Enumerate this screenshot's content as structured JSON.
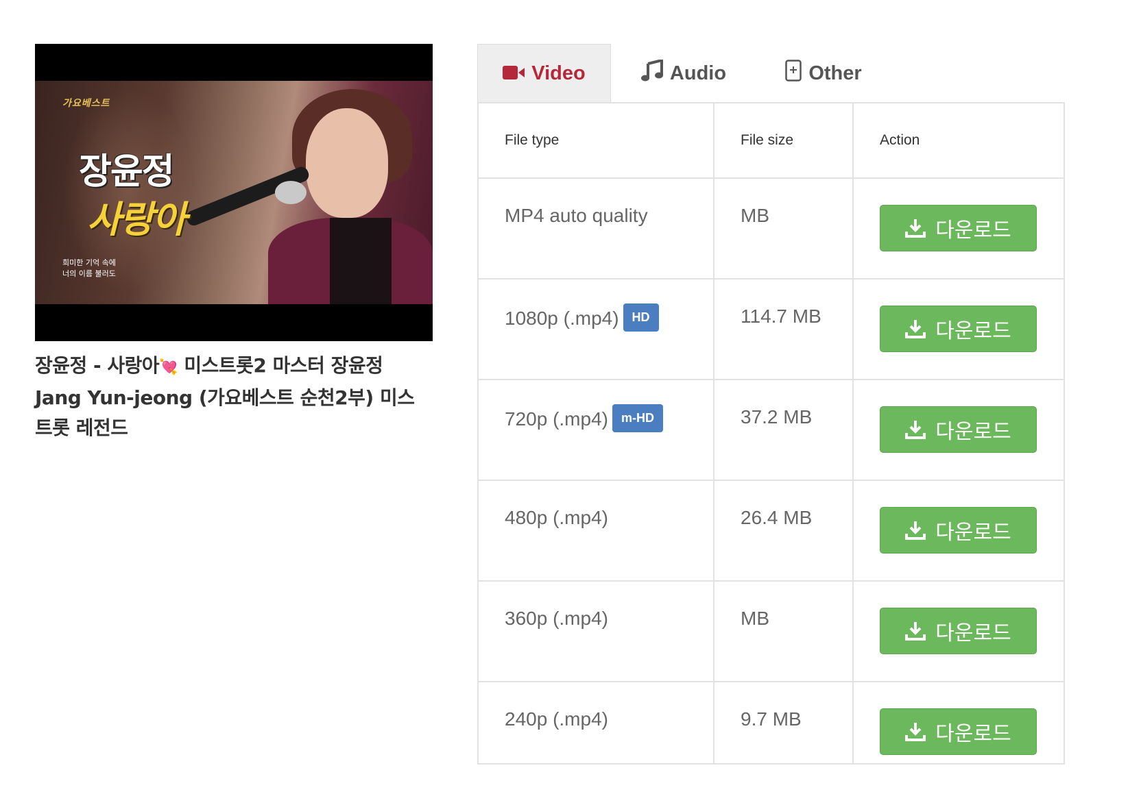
{
  "video": {
    "thumbnail": {
      "logo_text": "가요베스트",
      "title_line1": "장윤정",
      "title_line2": "사랑아",
      "subtitle_line1": "희미한 기억 속에",
      "subtitle_line2": "너의 이름 불러도"
    },
    "title_part1": "장윤정 - 사랑아",
    "title_emoji": "💘",
    "title_part2": " 미스트롯2 마스터 장윤정 Jang Yun-jeong (가요베스트 순천2부) 미스트롯 레전드"
  },
  "tabs": [
    {
      "label": "Video",
      "icon": "video-camera-icon",
      "active": true
    },
    {
      "label": "Audio",
      "icon": "music-note-icon",
      "active": false
    },
    {
      "label": "Other",
      "icon": "file-plus-icon",
      "active": false
    }
  ],
  "table": {
    "headers": {
      "file_type": "File type",
      "file_size": "File size",
      "action": "Action"
    },
    "rows": [
      {
        "type": "MP4 auto quality",
        "badge": "",
        "size": "MB",
        "action": "다운로드"
      },
      {
        "type": "1080p (.mp4)",
        "badge": "HD",
        "size": "114.7 MB",
        "action": "다운로드"
      },
      {
        "type": "720p (.mp4)",
        "badge": "m-HD",
        "size": "37.2 MB",
        "action": "다운로드"
      },
      {
        "type": "480p (.mp4)",
        "badge": "",
        "size": "26.4 MB",
        "action": "다운로드"
      },
      {
        "type": "360p (.mp4)",
        "badge": "",
        "size": "MB",
        "action": "다운로드"
      },
      {
        "type": "240p (.mp4)",
        "badge": "",
        "size": "9.7 MB",
        "action": "다운로드"
      }
    ]
  },
  "colors": {
    "active_tab": "#b5283c",
    "download_button": "#6cb85c",
    "badge": "#4a7ec0"
  }
}
